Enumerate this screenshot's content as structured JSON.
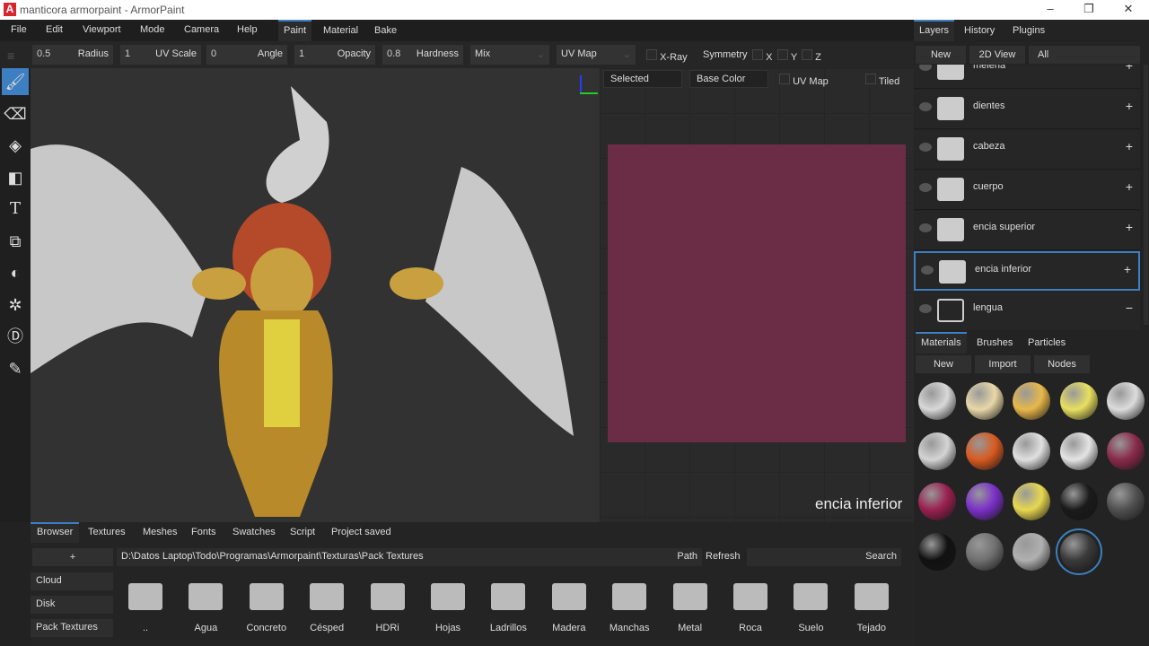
{
  "window": {
    "title": "manticora armorpaint - ArmorPaint",
    "logo": "A"
  },
  "menu": [
    "File",
    "Edit",
    "Viewport",
    "Mode",
    "Camera",
    "Help"
  ],
  "workspace_tabs": [
    {
      "label": "Paint",
      "active": true
    },
    {
      "label": "Material"
    },
    {
      "label": "Bake"
    }
  ],
  "toolbar": {
    "fields": [
      {
        "value": "0.5",
        "label": "Radius"
      },
      {
        "value": "1",
        "label": "UV Scale"
      },
      {
        "value": "0",
        "label": "Angle"
      },
      {
        "value": "1",
        "label": "Opacity"
      },
      {
        "value": "0.8",
        "label": "Hardness"
      }
    ],
    "blend": "Mix",
    "tex_coord": "UV Map",
    "xray": "X-Ray",
    "symmetry": "Symmetry",
    "x": "X",
    "y": "Y",
    "z": "Z"
  },
  "tools": [
    "brush-icon",
    "eraser-icon",
    "fill-icon",
    "decal-icon",
    "text-icon",
    "clone-icon",
    "blur-icon",
    "particle-icon",
    "bake-icon",
    "picker-icon"
  ],
  "view2d": {
    "layer_mode": "Selected",
    "channel": "Base Color",
    "uvmap": "UV Map",
    "tiled": "Tiled",
    "layer_label": "encia inferior",
    "texture_color": "#6b2d45"
  },
  "right": {
    "tabs": [
      "Layers",
      "History",
      "Plugins"
    ],
    "buttons": {
      "new": "New",
      "view2d": "2D View",
      "filter": "All"
    },
    "layers": [
      {
        "name": "melena",
        "action": "+"
      },
      {
        "name": "dientes",
        "action": "+"
      },
      {
        "name": "cabeza",
        "action": "+"
      },
      {
        "name": "cuerpo",
        "action": "+"
      },
      {
        "name": "encia superior",
        "action": "+"
      },
      {
        "name": "encia inferior",
        "action": "+",
        "selected": true
      },
      {
        "name": "lengua",
        "action": "−"
      }
    ],
    "material_tabs": [
      "Materials",
      "Brushes",
      "Particles"
    ],
    "material_buttons": [
      "New",
      "Import",
      "Nodes"
    ],
    "materials": [
      "#d8d8d8",
      "#e8d8a8",
      "#e8b84a",
      "#e8e060",
      "#dcdcdc",
      "#d4d4d4",
      "#d85a20",
      "#e0e0e0",
      "#e4e4e4",
      "#8a2a4a",
      "#9a2050",
      "#7a30c8",
      "#e8d850",
      "#1a1a1a",
      "#505050",
      "#111111",
      "#707070",
      "#b0b0b0",
      "#3a3a3a"
    ]
  },
  "browser": {
    "tabs": [
      "Browser",
      "Textures",
      "Meshes",
      "Fonts",
      "Swatches",
      "Script"
    ],
    "status": "Project saved",
    "add": "+",
    "path": "D:\\Datos Laptop\\Todo\\Programas\\Armorpaint\\Texturas\\Pack Textures",
    "path_label": "Path",
    "refresh": "Refresh",
    "search": "Search",
    "sources": [
      "Cloud",
      "Disk",
      "Pack Textures"
    ],
    "folders": [
      "..",
      "Agua",
      "Concreto",
      "Césped",
      "HDRi",
      "Hojas",
      "Ladrillos",
      "Madera",
      "Manchas",
      "Metal",
      "Roca",
      "Suelo",
      "Tejado"
    ]
  }
}
